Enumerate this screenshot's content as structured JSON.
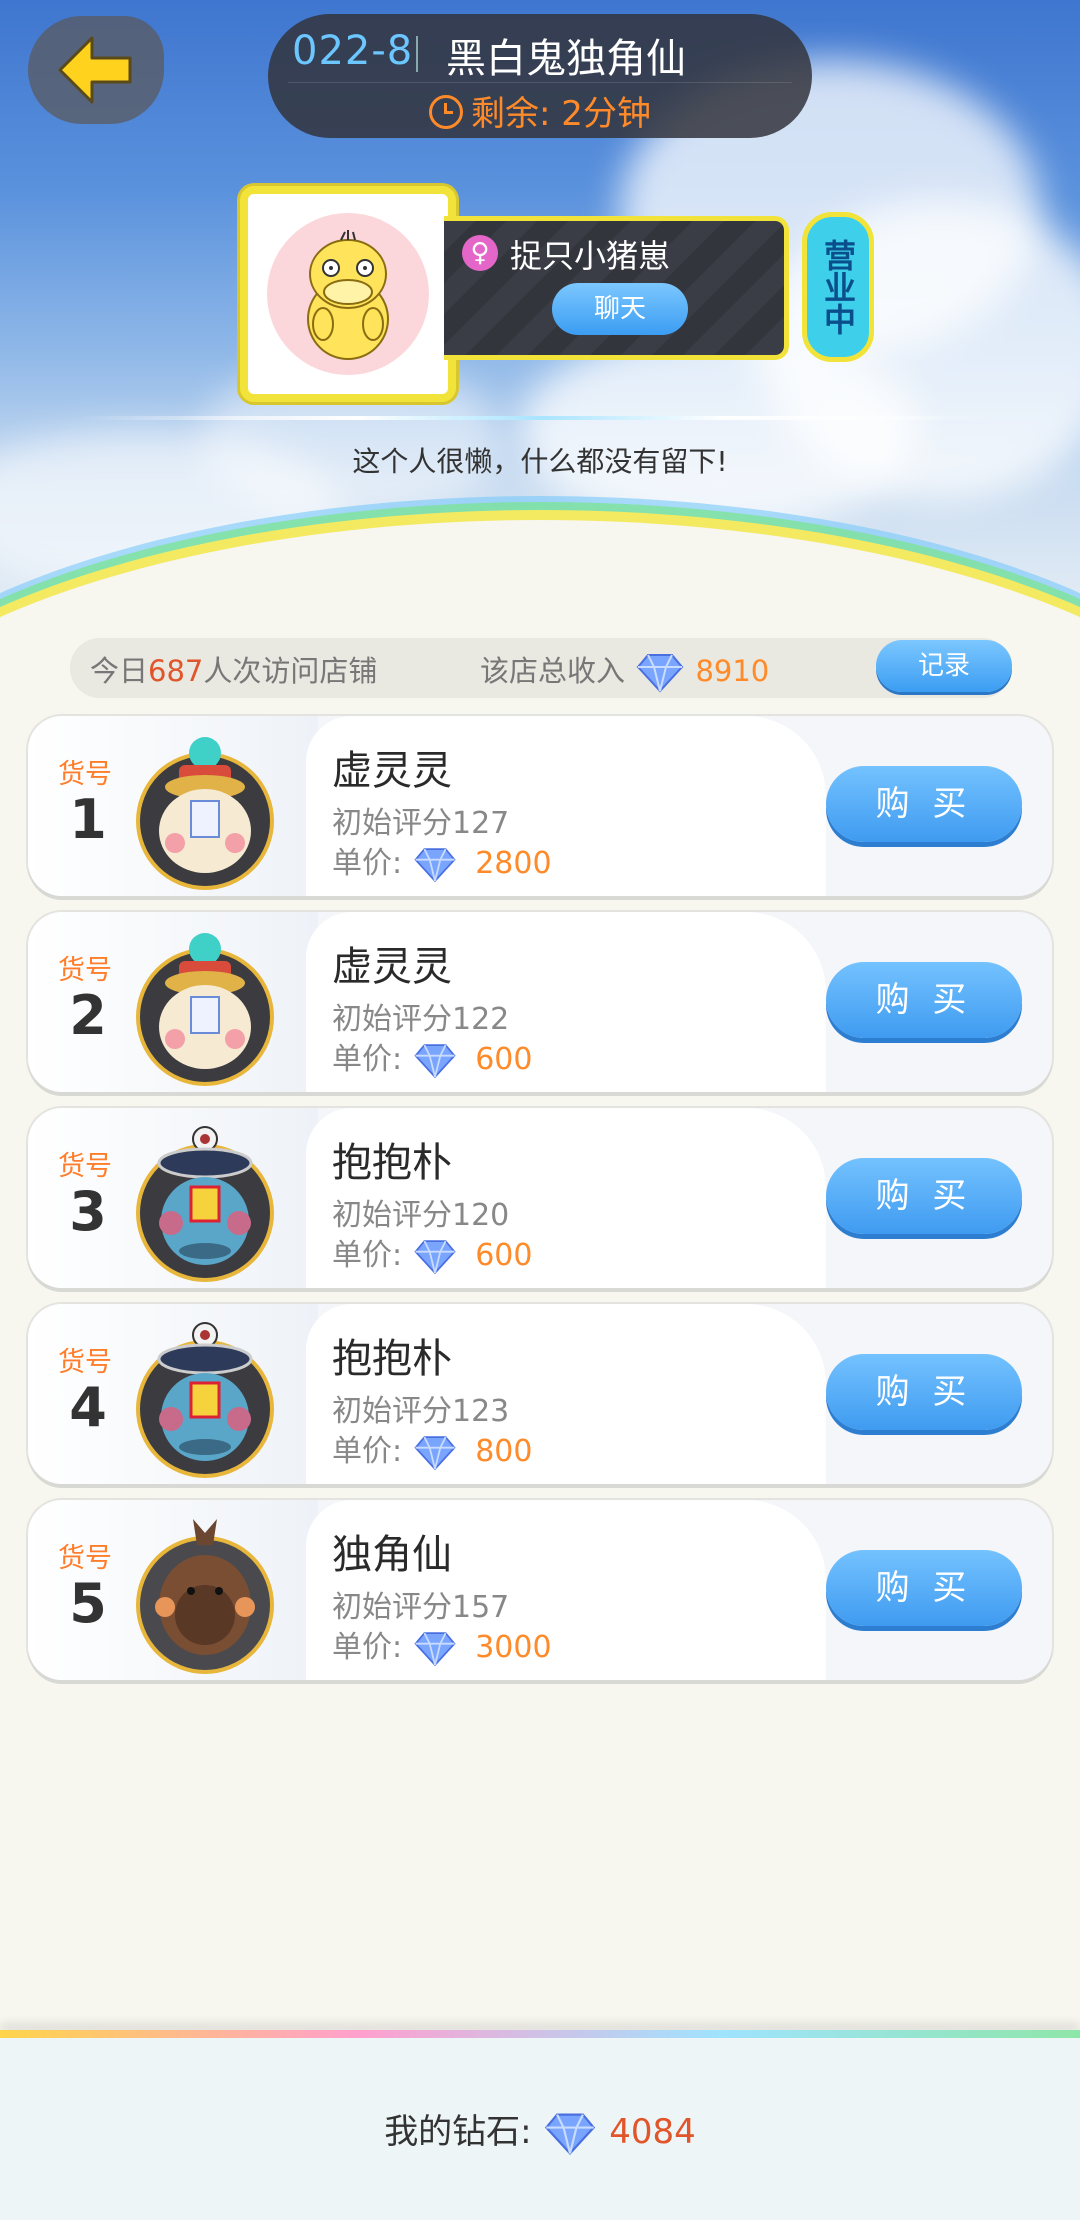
{
  "header": {
    "shop_code": "022-8",
    "shop_title": "黑白鬼独角仙",
    "remaining": "剩余: 2分钟"
  },
  "owner": {
    "name": "捉只小猪崽",
    "gender_symbol": "♀",
    "chat_label": "聊天",
    "status": "营业中",
    "signature": "这个人很懒，什么都没有留下!"
  },
  "stats": {
    "visits_prefix": "今日",
    "visits_count": "687",
    "visits_suffix": "人次访问店铺",
    "income_label": "该店总收入",
    "income_value": "8910",
    "record_label": "记录"
  },
  "goods_label": "货号",
  "price_label": "单价:",
  "buy_label": "购 买",
  "items": [
    {
      "num": "1",
      "name": "虚灵灵",
      "score": "初始评分127",
      "price": "2800",
      "pet": "xulingling"
    },
    {
      "num": "2",
      "name": "虚灵灵",
      "score": "初始评分122",
      "price": "600",
      "pet": "xulingling"
    },
    {
      "num": "3",
      "name": "抱抱朴",
      "score": "初始评分120",
      "price": "600",
      "pet": "baobaopu"
    },
    {
      "num": "4",
      "name": "抱抱朴",
      "score": "初始评分123",
      "price": "800",
      "pet": "baobaopu"
    },
    {
      "num": "5",
      "name": "独角仙",
      "score": "初始评分157",
      "price": "3000",
      "pet": "dujiaoxian"
    }
  ],
  "footer": {
    "label": "我的钻石:",
    "value": "4084"
  },
  "colors": {
    "accent_blue": "#3f9bf0",
    "price_orange": "#ff8a2a",
    "frame_yellow": "#f2e33a"
  }
}
